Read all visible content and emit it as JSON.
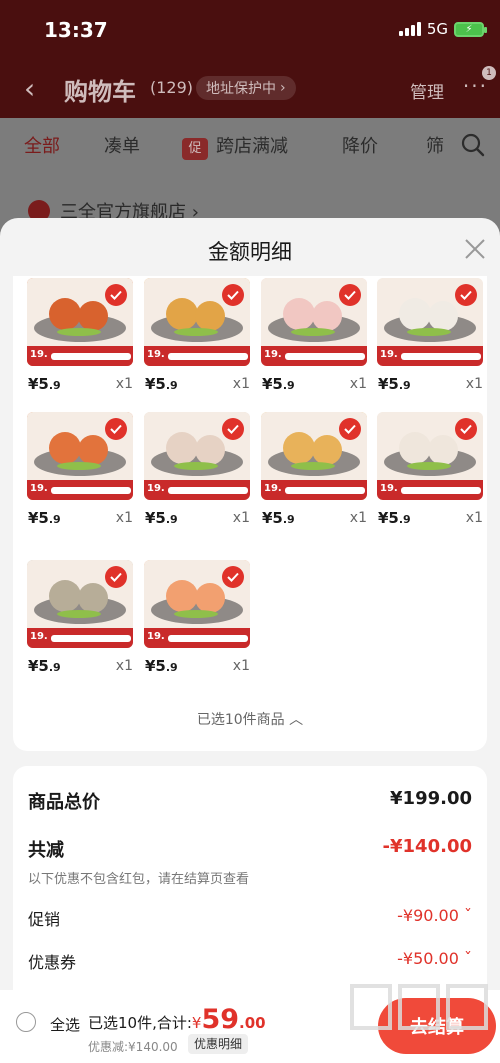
{
  "status_bar": {
    "time": "13:37",
    "network": "5G"
  },
  "nav": {
    "title": "购物车",
    "count": "(129)",
    "address_protect": "地址保护中",
    "manage": "管理",
    "more_badge": "1"
  },
  "filters": {
    "all": "全部",
    "bundle": "凑单",
    "promo_tag": "促",
    "cross_store": "跨店满减",
    "price_drop": "降价",
    "filter": "筛"
  },
  "store": {
    "name": "三全官方旗舰店"
  },
  "sheet": {
    "title": "金额明细",
    "selected_summary": "已选10件商品"
  },
  "items": [
    {
      "price_int": "¥5",
      "price_dec": ".9",
      "qty": "x1",
      "banner_price": "19.",
      "food_color": "#d8622e"
    },
    {
      "price_int": "¥5",
      "price_dec": ".9",
      "qty": "x1",
      "banner_price": "19.",
      "food_color": "#e2a447"
    },
    {
      "price_int": "¥5",
      "price_dec": ".9",
      "qty": "x1",
      "banner_price": "19.",
      "food_color": "#f1c7c2"
    },
    {
      "price_int": "¥5",
      "price_dec": ".9",
      "qty": "x1",
      "banner_price": "19.",
      "food_color": "#f0ebe4"
    },
    {
      "price_int": "¥5",
      "price_dec": ".9",
      "qty": "x1",
      "banner_price": "19.",
      "food_color": "#e2733c"
    },
    {
      "price_int": "¥5",
      "price_dec": ".9",
      "qty": "x1",
      "banner_price": "19.",
      "food_color": "#e6d2c4"
    },
    {
      "price_int": "¥5",
      "price_dec": ".9",
      "qty": "x1",
      "banner_price": "19.",
      "food_color": "#e8b25a"
    },
    {
      "price_int": "¥5",
      "price_dec": ".9",
      "qty": "x1",
      "banner_price": "19.",
      "food_color": "#efe6dc"
    },
    {
      "price_int": "¥5",
      "price_dec": ".9",
      "qty": "x1",
      "banner_price": "19.",
      "food_color": "#b7ad98"
    },
    {
      "price_int": "¥5",
      "price_dec": ".9",
      "qty": "x1",
      "banner_price": "19.",
      "food_color": "#f2a070"
    }
  ],
  "summary": {
    "total_label": "商品总价",
    "total_value": "¥199.00",
    "reduce_label": "共减",
    "reduce_value": "-¥140.00",
    "reduce_note": "以下优惠不包含红包，请在结算页查看",
    "promo_label": "促销",
    "promo_value": "-¥90.00",
    "coupon_label": "优惠券",
    "coupon_value": "-¥50.00"
  },
  "bottom": {
    "select_all": "全选",
    "selected_text": "已选10件,合计:",
    "currency": "¥",
    "amount_int": "59",
    "amount_dec": ".00",
    "discount_text": "优惠减:¥140.00",
    "detail_chip": "优惠明细",
    "checkout": "去结算"
  },
  "colors": {
    "accent": "#e0322a",
    "header_bg": "#4a0f0f"
  }
}
